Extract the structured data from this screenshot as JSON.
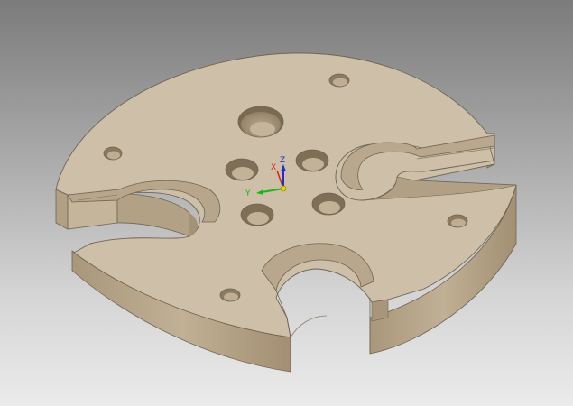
{
  "viewport": {
    "background_top": "#7b7b7b",
    "background_bottom": "#ebebeb"
  },
  "part": {
    "top_face_color": "#cdbfa8",
    "side_face_color": "#b8a78c",
    "shadow_color": "#9e8c72",
    "edge_color": "#6f6553",
    "hole_count": 10,
    "slot_count": 3
  },
  "triad": {
    "x_label": "X",
    "y_label": "Y",
    "z_label": "Z",
    "x_color": "#e02020",
    "y_color": "#18b818",
    "z_color": "#1c2fd0",
    "origin_color": "#f0d000"
  }
}
